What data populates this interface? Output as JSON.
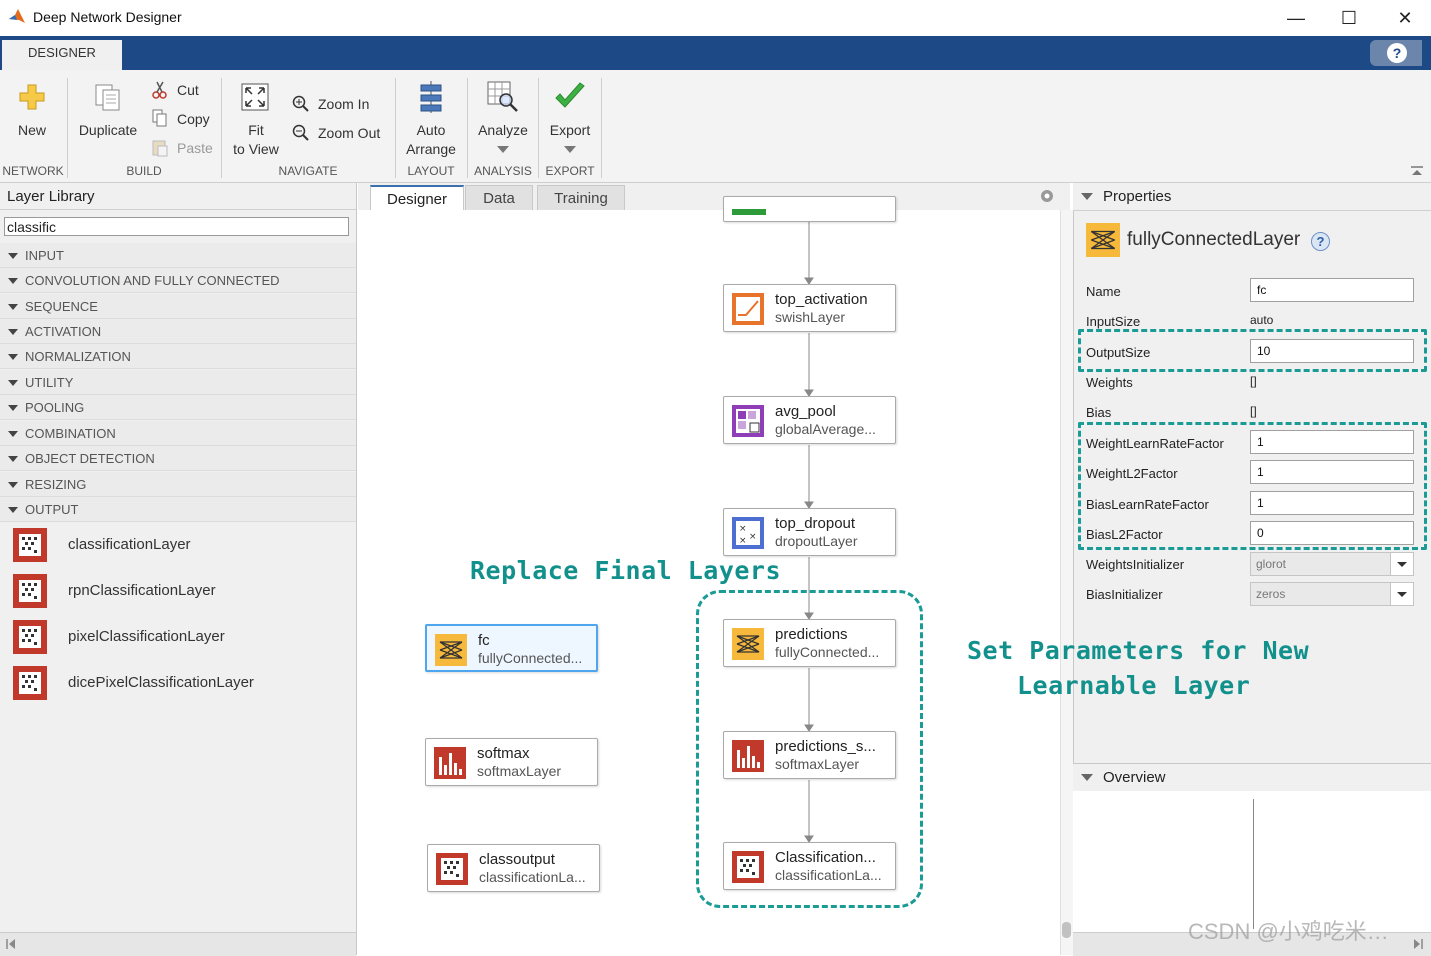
{
  "window": {
    "title": "Deep Network Designer"
  },
  "ribbon": {
    "tab": "DESIGNER",
    "help": "?",
    "buttons": {
      "new": "New",
      "duplicate": "Duplicate",
      "cut": "Cut",
      "copy": "Copy",
      "paste": "Paste",
      "fit_line1": "Fit",
      "fit_line2": "to View",
      "zoom_in": "Zoom In",
      "zoom_out": "Zoom Out",
      "auto_line1": "Auto",
      "auto_line2": "Arrange",
      "analyze": "Analyze",
      "export": "Export"
    },
    "groups": {
      "network": "NETWORK",
      "build": "BUILD",
      "navigate": "NAVIGATE",
      "layout": "LAYOUT",
      "analysis": "ANALYSIS",
      "export": "EXPORT"
    }
  },
  "library": {
    "title": "Layer Library",
    "search_value": "classific",
    "categories": [
      "INPUT",
      "CONVOLUTION AND FULLY CONNECTED",
      "SEQUENCE",
      "ACTIVATION",
      "NORMALIZATION",
      "UTILITY",
      "POOLING",
      "COMBINATION",
      "OBJECT DETECTION",
      "RESIZING",
      "OUTPUT"
    ],
    "items": [
      "classificationLayer",
      "rpnClassificationLayer",
      "pixelClassificationLayer",
      "dicePixelClassificationLayer"
    ]
  },
  "canvas": {
    "tabs": [
      "Designer",
      "Data",
      "Training"
    ],
    "nodes": {
      "top_activation": {
        "name": "top_activation",
        "type": "swishLayer"
      },
      "avg_pool": {
        "name": "avg_pool",
        "type": "globalAverage..."
      },
      "top_dropout": {
        "name": "top_dropout",
        "type": "dropoutLayer"
      },
      "predictions": {
        "name": "predictions",
        "type": "fullyConnected..."
      },
      "predictions_s": {
        "name": "predictions_s...",
        "type": "softmaxLayer"
      },
      "classification": {
        "name": "Classification...",
        "type": "classificationLa..."
      },
      "fc": {
        "name": "fc",
        "type": "fullyConnected..."
      },
      "softmax": {
        "name": "softmax",
        "type": "softmaxLayer"
      },
      "classoutput": {
        "name": "classoutput",
        "type": "classificationLa..."
      }
    },
    "annotation_replace": "Replace Final Layers"
  },
  "properties": {
    "title": "Properties",
    "layer_title": "fullyConnectedLayer",
    "rows": {
      "name": {
        "label": "Name",
        "value": "fc"
      },
      "input_size": {
        "label": "InputSize",
        "value": "auto"
      },
      "output_size": {
        "label": "OutputSize",
        "value": "10"
      },
      "weights": {
        "label": "Weights",
        "value": "[]"
      },
      "bias": {
        "label": "Bias",
        "value": "[]"
      },
      "wlr": {
        "label": "WeightLearnRateFactor",
        "value": "1"
      },
      "wl2": {
        "label": "WeightL2Factor",
        "value": "1"
      },
      "blr": {
        "label": "BiasLearnRateFactor",
        "value": "1"
      },
      "bl2": {
        "label": "BiasL2Factor",
        "value": "0"
      },
      "winit": {
        "label": "WeightsInitializer",
        "value": "glorot"
      },
      "binit": {
        "label": "BiasInitializer",
        "value": "zeros"
      }
    },
    "annotation_line1": "Set Parameters for New",
    "annotation_line2": "Learnable Layer"
  },
  "overview": {
    "title": "Overview"
  },
  "watermark": "CSDN @小鸡吃米…",
  "colors": {
    "ribbon_blue": "#1d4a87",
    "annotation_teal": "#11908c",
    "selection_blue": "#4ea7ee"
  }
}
